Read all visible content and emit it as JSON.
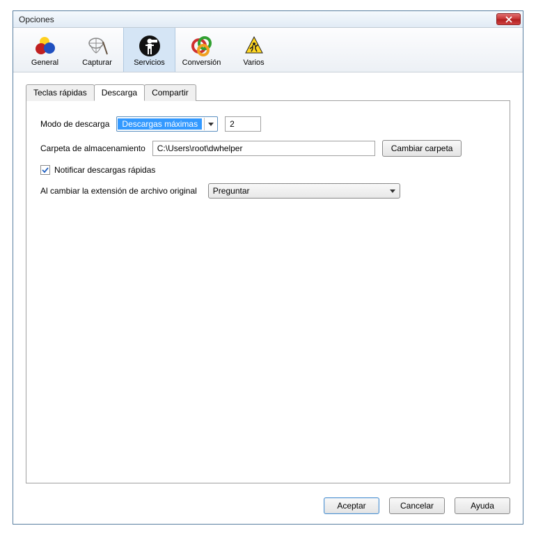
{
  "window": {
    "title": "Opciones"
  },
  "toolbar": {
    "items": [
      {
        "label": "General",
        "icon": "balls"
      },
      {
        "label": "Capturar",
        "icon": "net"
      },
      {
        "label": "Servicios",
        "icon": "person",
        "active": true
      },
      {
        "label": "Conversión",
        "icon": "rings"
      },
      {
        "label": "Varios",
        "icon": "worker"
      }
    ]
  },
  "tabs": {
    "items": [
      {
        "label": "Teclas rápidas"
      },
      {
        "label": "Descarga",
        "active": true
      },
      {
        "label": "Compartir"
      }
    ]
  },
  "form": {
    "download_mode_label": "Modo de descarga",
    "download_mode_value": "Descargas máximas",
    "download_count": "2",
    "storage_folder_label": "Carpeta de almacenamiento",
    "storage_folder_value": "C:\\Users\\root\\dwhelper",
    "change_folder_button": "Cambiar carpeta",
    "notify_checkbox_label": "Notificar descargas rápidas",
    "notify_checked": true,
    "extension_change_label": "Al cambiar la extensión de archivo original",
    "extension_change_value": "Preguntar"
  },
  "footer": {
    "accept": "Aceptar",
    "cancel": "Cancelar",
    "help": "Ayuda"
  }
}
